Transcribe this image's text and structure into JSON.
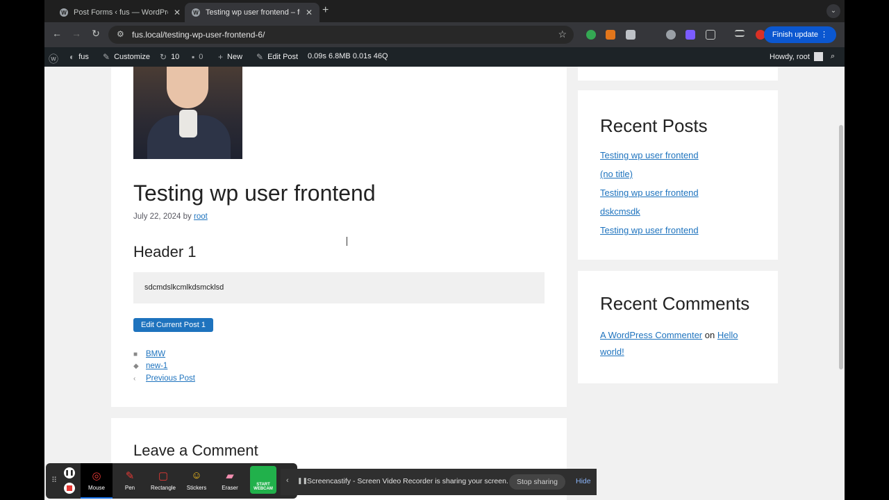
{
  "browser": {
    "tabs": [
      {
        "title": "Post Forms ‹ fus — WordPress"
      },
      {
        "title": "Testing wp user frontend – fus"
      }
    ],
    "url": "fus.local/testing-wp-user-frontend-6/",
    "finish_update_label": "Finish update"
  },
  "adminbar": {
    "site_name": "fus",
    "customize": "Customize",
    "updates_count": "10",
    "comments_count": "0",
    "new_label": "New",
    "edit_post": "Edit Post",
    "query_stats": "0.09s  6.8MB  0.01s  46Q",
    "howdy": "Howdy, root"
  },
  "post": {
    "title": "Testing wp user frontend",
    "date": "July 22, 2024",
    "by": "by",
    "author": "root",
    "header1": "Header 1",
    "content": "sdcmdslkcmlkdsmcklsd",
    "edit_button": "Edit Current Post 1",
    "category": "BMW",
    "tag": "new-1",
    "previous_post": "Previous Post"
  },
  "comments": {
    "title": "Leave a Comment"
  },
  "sidebar": {
    "recent_posts_title": "Recent Posts",
    "recent_posts": [
      "Testing wp user frontend",
      "(no title)",
      "Testing wp user frontend",
      "dskcmsdk",
      "Testing wp user frontend"
    ],
    "recent_comments_title": "Recent Comments",
    "commenter": "A WordPress Commenter",
    "on_word": "on",
    "comment_post": "Hello world!"
  },
  "screencastify": {
    "tools": [
      "Mouse",
      "Pen",
      "Rectangle",
      "Stickers",
      "Eraser"
    ],
    "webcam_label": "START WEBCAM",
    "sharing_text": "Screencastify - Screen Video Recorder is sharing your screen.",
    "stop_sharing": "Stop sharing",
    "hide": "Hide"
  },
  "colors": {
    "link": "#1e73be",
    "adminbar": "#1d2327",
    "chrome_dark": "#1f1f1f",
    "update_button": "#0b57d0"
  }
}
